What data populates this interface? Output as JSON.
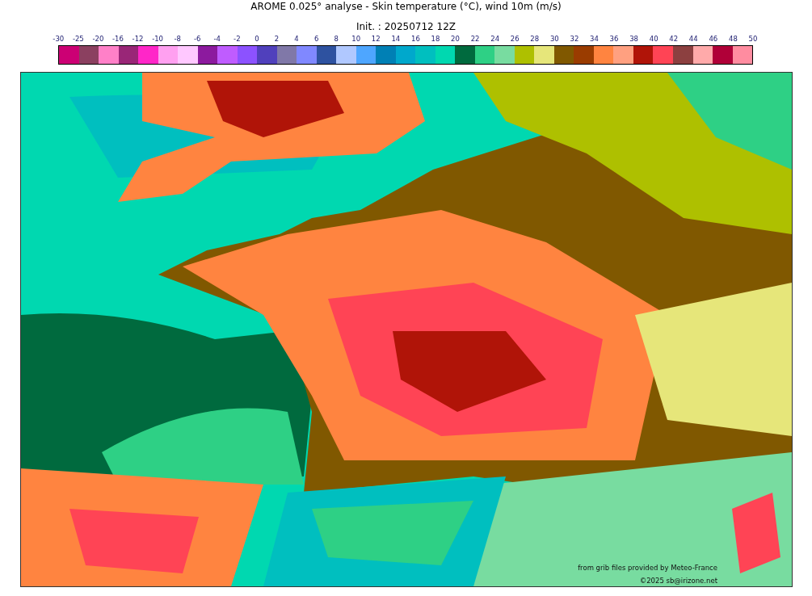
{
  "title": "AROME 0.025° analyse - Skin temperature (°C), wind 10m (m/s)",
  "subtitle": "Init. : 20250712 12Z",
  "legend": {
    "ticks": [
      "-30",
      "-25",
      "-20",
      "-16",
      "-12",
      "-10",
      "-8",
      "-6",
      "-4",
      "-2",
      "0",
      "2",
      "4",
      "6",
      "8",
      "10",
      "12",
      "14",
      "16",
      "18",
      "20",
      "22",
      "24",
      "26",
      "28",
      "30",
      "32",
      "34",
      "36",
      "38",
      "40",
      "42",
      "44",
      "46",
      "48",
      "50"
    ],
    "cells": [
      {
        "color": "#cc0074"
      },
      {
        "color": "#8b4060"
      },
      {
        "color": "#ff80c8"
      },
      {
        "color": "#992677"
      },
      {
        "color": "#ff26c8"
      },
      {
        "color": "#ffa0f0"
      },
      {
        "color": "#ffc8ff"
      },
      {
        "color": "#8c1a9e"
      },
      {
        "color": "#bf5cff"
      },
      {
        "color": "#8c52ff"
      },
      {
        "color": "#5040bc"
      },
      {
        "color": "#8078a8"
      },
      {
        "color": "#8088ff"
      },
      {
        "color": "#2e52a0"
      },
      {
        "color": "#b0c8ff"
      },
      {
        "color": "#4ea6ff"
      },
      {
        "color": "#0080b5"
      },
      {
        "color": "#00a8cc"
      },
      {
        "color": "#00bfbf"
      },
      {
        "color": "#00d8b0"
      },
      {
        "color": "#006a3e"
      },
      {
        "color": "#2ed085"
      },
      {
        "color": "#78dca0"
      },
      {
        "color": "#aec000"
      },
      {
        "color": "#e6e67a"
      },
      {
        "color": "#805800"
      },
      {
        "color": "#9a3c00"
      },
      {
        "color": "#ff8440"
      },
      {
        "color": "#ffa080"
      },
      {
        "color": "#b01408"
      },
      {
        "color": "#ff4455"
      },
      {
        "color": "#8c4040"
      },
      {
        "color": "#ffaaaa"
      },
      {
        "color": "#b00038"
      },
      {
        "color": "#ff8ca0"
      }
    ]
  },
  "map": {
    "source": "from grib files provided by Meteo-France",
    "copyright": "©2025 sb@irizone.net"
  }
}
